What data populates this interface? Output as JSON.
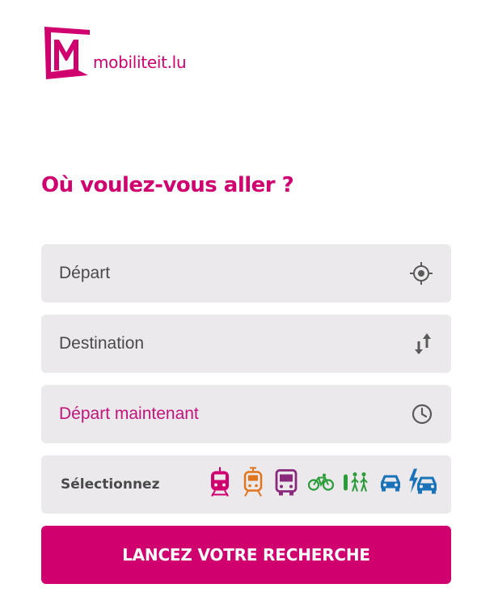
{
  "logo": {
    "text": "mobiliteit.lu"
  },
  "heading": "Où voulez-vous aller ?",
  "fields": {
    "departure": "Départ",
    "destination": "Destination",
    "time": "Départ maintenant"
  },
  "modes": {
    "label": "Sélectionnez",
    "items": [
      {
        "name": "train",
        "color": "#d1006f"
      },
      {
        "name": "tram",
        "color": "#e2741b"
      },
      {
        "name": "bus",
        "color": "#8b2a7c"
      },
      {
        "name": "bike",
        "color": "#2a9d3a"
      },
      {
        "name": "walk",
        "color": "#2a9d3a"
      },
      {
        "name": "car",
        "color": "#1a73b8"
      },
      {
        "name": "electric-car",
        "color": "#1a73b8"
      }
    ]
  },
  "search_button": "LANCEZ VOTRE RECHERCHE",
  "colors": {
    "brand": "#d1006f",
    "field_bg": "#ebe9ec",
    "icon": "#5a5a5a"
  }
}
